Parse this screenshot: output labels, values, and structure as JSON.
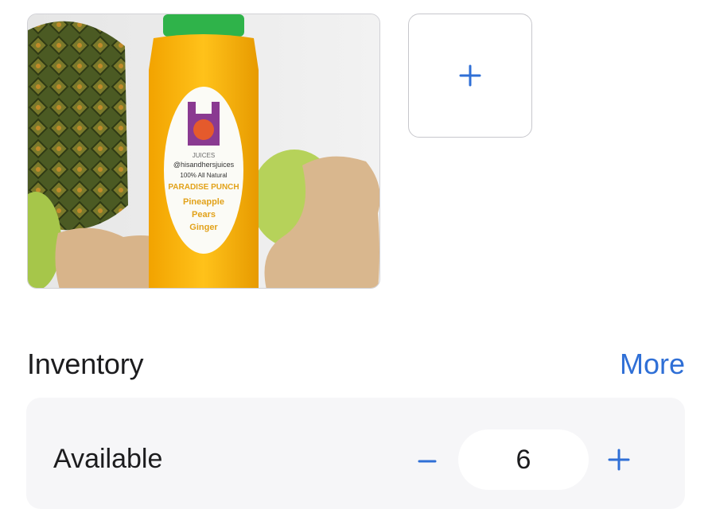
{
  "colors": {
    "accent": "#2f6fd6",
    "text": "#1c1c1e",
    "card": "#f6f6f8"
  },
  "photo": {
    "label": {
      "brand": "JUICES",
      "handle": "@hisandhersjuices",
      "tagline": "100% All Natural",
      "product": "PARADISE PUNCH",
      "ingredients": [
        "Pineapple",
        "Pears",
        "Ginger"
      ]
    }
  },
  "add_photo": {
    "icon": "plus-icon"
  },
  "inventory": {
    "title": "Inventory",
    "more_label": "More",
    "row_label": "Available",
    "quantity": "6",
    "minus_icon": "minus-icon",
    "plus_icon": "plus-icon"
  }
}
